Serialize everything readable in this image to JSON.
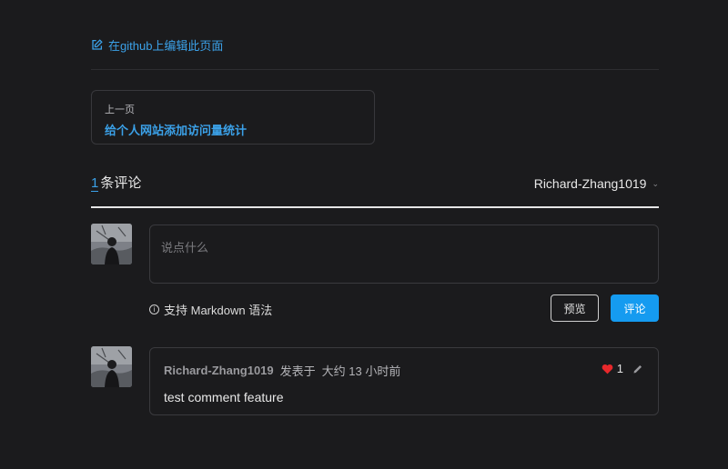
{
  "edit_link": {
    "label": "在github上编辑此页面",
    "icon": "edit-icon"
  },
  "pagination": {
    "prev_sub": "上一页",
    "prev_title": "给个人网站添加访问量统计"
  },
  "comments": {
    "count": "1",
    "count_suffix": "条评论",
    "user": "Richard-Zhang1019",
    "input_placeholder": "说点什么",
    "markdown_hint": "支持 Markdown 语法",
    "preview_label": "预览",
    "submit_label": "评论",
    "items": [
      {
        "author": "Richard-Zhang1019",
        "posted": "发表于",
        "time": "大约 13 小时前",
        "likes": "1",
        "body": "test comment feature"
      }
    ]
  },
  "colors": {
    "accent": "#3ba1e8",
    "button": "#159bf0",
    "heart": "#e8282b"
  }
}
